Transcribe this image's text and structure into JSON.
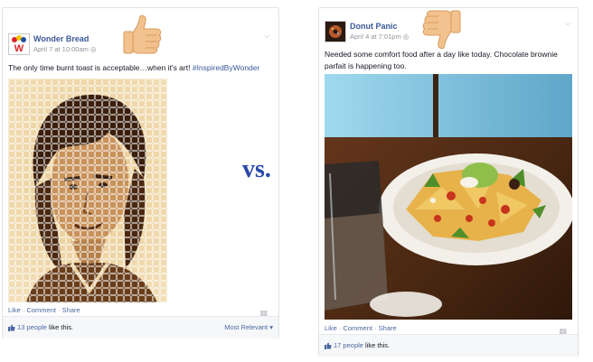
{
  "left_post": {
    "page_name": "Wonder Bread",
    "timestamp": "April 7 at 10:00am",
    "logo_letter": "W",
    "text_main": "The only time burnt toast is acceptable…when it's art! ",
    "hashtag": "#InspiredByWonder",
    "actions": {
      "like": "Like",
      "comment": "Comment",
      "share": "Share",
      "sep": "·"
    },
    "likes_count": "13 people",
    "likes_suffix": " like this.",
    "sort_label": "Most Relevant",
    "thumb": "thumbs-up"
  },
  "right_post": {
    "page_name": "Donut Panic",
    "timestamp": "April 4 at 7:01pm",
    "text": "Needed some comfort food after a day like today. Chocolate brownie parfait is happening too.",
    "actions": {
      "like": "Like",
      "comment": "Comment",
      "share": "Share",
      "sep": "·"
    },
    "likes_count": "17 people",
    "likes_suffix": " like this.",
    "thumb": "thumbs-down"
  },
  "vs_label": "vs.",
  "colors": {
    "facebook_blue": "#3b5998",
    "vs_blue": "#2a49a8",
    "thumb_skin": "#f2c28e"
  }
}
